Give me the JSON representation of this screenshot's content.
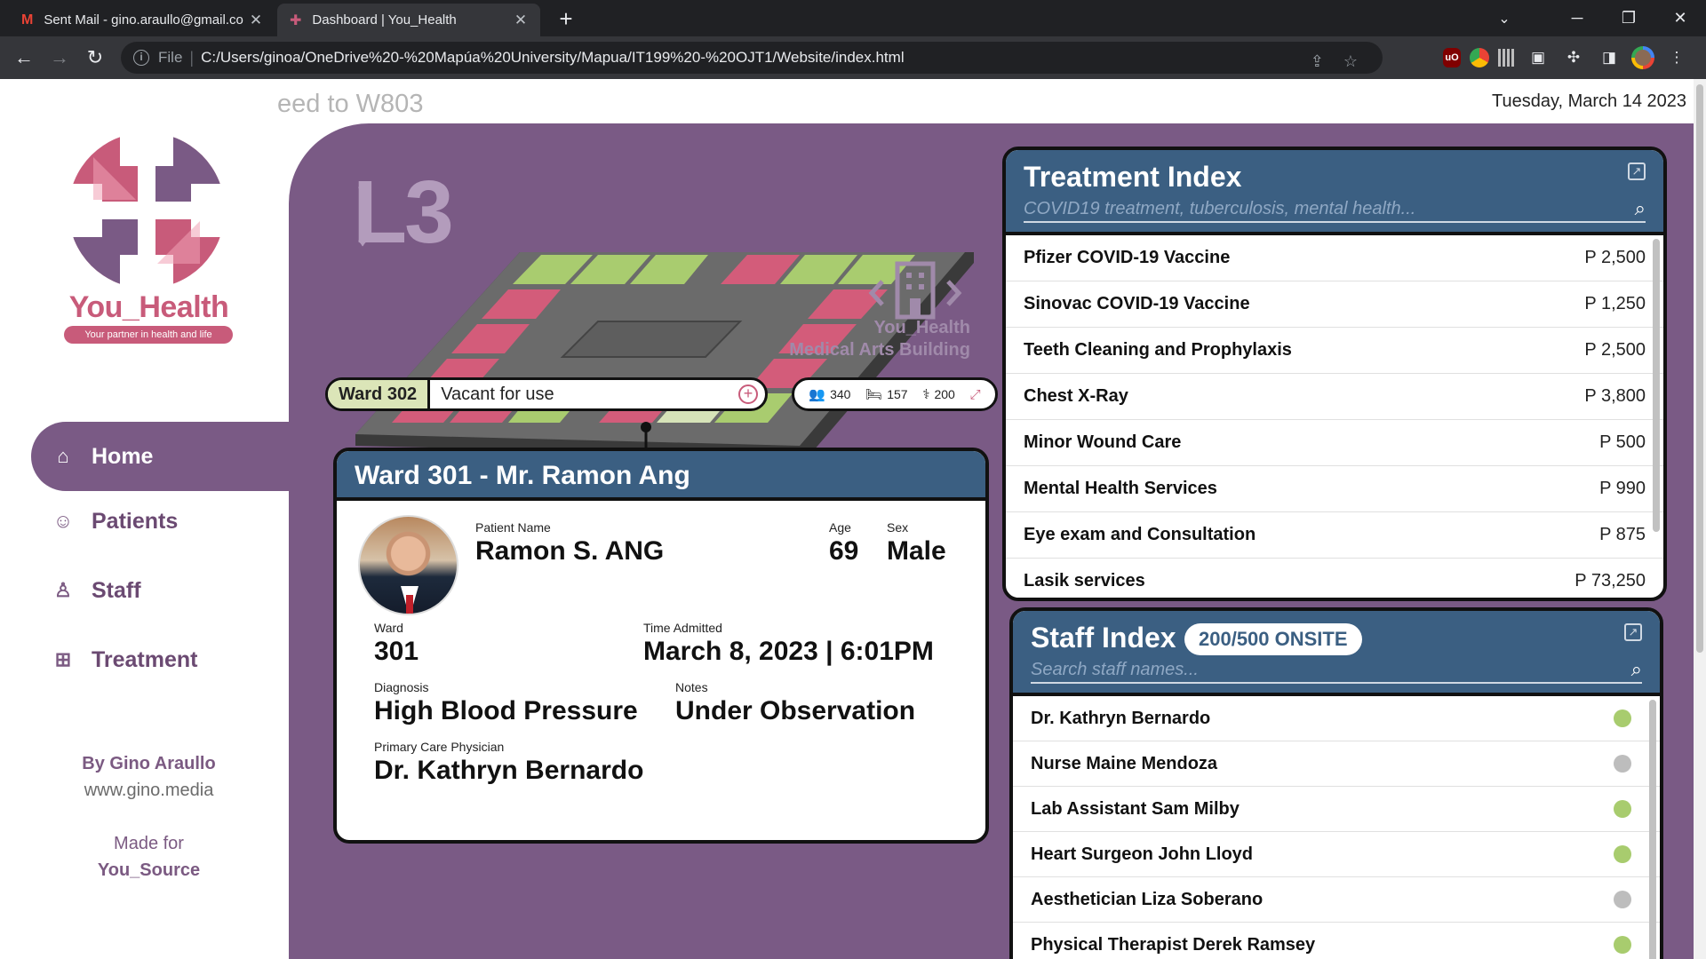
{
  "browser": {
    "tabs": [
      {
        "title": "Sent Mail - gino.araullo@gmail.co",
        "icon": "gmail-icon"
      },
      {
        "title": "Dashboard | You_Health",
        "icon": "you-health-favicon"
      }
    ],
    "address": {
      "scheme_label": "File",
      "url": "C:/Users/ginoa/OneDrive%20-%20Mapúa%20University/Mapua/IT199%20-%20OJT1/Website/index.html"
    }
  },
  "brand": {
    "name": "You_Health",
    "tagline": "Your partner in health and life",
    "color_primary": "#c85b7a",
    "color_secondary": "#7a5a85"
  },
  "nav": {
    "items": [
      {
        "label": "Home",
        "icon": "home-icon",
        "active": true
      },
      {
        "label": "Patients",
        "icon": "smiley-icon",
        "active": false
      },
      {
        "label": "Staff",
        "icon": "person-icon",
        "active": false
      },
      {
        "label": "Treatment",
        "icon": "medicine-icon",
        "active": false
      }
    ]
  },
  "credits": {
    "by": "By Gino Araullo",
    "site": "www.gino.media",
    "made_for_label": "Made for",
    "made_for": "You_Source"
  },
  "header": {
    "marquee": "eed to W803",
    "date": "Tuesday, March 14 2023"
  },
  "floor": {
    "level": "L3",
    "building_name": "You_Health",
    "building_sub": "Medical Arts Building",
    "selected_ward": "Ward 302",
    "selected_status": "Vacant for use",
    "stats": {
      "people": "340",
      "beds": "157",
      "doctors": "200"
    }
  },
  "patient_card": {
    "title": "Ward 301 - Mr. Ramon Ang",
    "labels": {
      "name": "Patient Name",
      "age": "Age",
      "sex": "Sex",
      "ward": "Ward",
      "time_admitted": "Time Admitted",
      "diagnosis": "Diagnosis",
      "notes": "Notes",
      "physician": "Primary Care Physician"
    },
    "name": "Ramon S. ANG",
    "age": "69",
    "sex": "Male",
    "ward": "301",
    "time_admitted": "March 8, 2023 | 6:01PM",
    "diagnosis": "High Blood Pressure",
    "notes": "Under Observation",
    "physician": "Dr. Kathryn Bernardo"
  },
  "treatment_index": {
    "title": "Treatment Index",
    "search_placeholder": "COVID19 treatment, tuberculosis, mental health...",
    "items": [
      {
        "name": "Pfizer COVID-19 Vaccine",
        "price": "P 2,500"
      },
      {
        "name": "Sinovac COVID-19 Vaccine",
        "price": "P 1,250"
      },
      {
        "name": "Teeth Cleaning and Prophylaxis",
        "price": "P 2,500"
      },
      {
        "name": "Chest X-Ray",
        "price": "P 3,800"
      },
      {
        "name": "Minor Wound Care",
        "price": "P 500"
      },
      {
        "name": "Mental Health Services",
        "price": "P 990"
      },
      {
        "name": "Eye exam and Consultation",
        "price": "P 875"
      },
      {
        "name": "Lasik services",
        "price": "P 73,250"
      }
    ]
  },
  "staff_index": {
    "title": "Staff Index",
    "onsite": "200/500 ONSITE",
    "search_placeholder": "Search staff names...",
    "status_colors": {
      "onsite": "#a8cc6e",
      "offsite": "#bdbdbd"
    },
    "items": [
      {
        "name": "Dr. Kathryn Bernardo",
        "onsite": true
      },
      {
        "name": "Nurse Maine Mendoza",
        "onsite": false
      },
      {
        "name": "Lab Assistant Sam Milby",
        "onsite": true
      },
      {
        "name": "Heart Surgeon John Lloyd",
        "onsite": true
      },
      {
        "name": "Aesthetician Liza Soberano",
        "onsite": false
      },
      {
        "name": "Physical Therapist Derek Ramsey",
        "onsite": true
      }
    ]
  }
}
